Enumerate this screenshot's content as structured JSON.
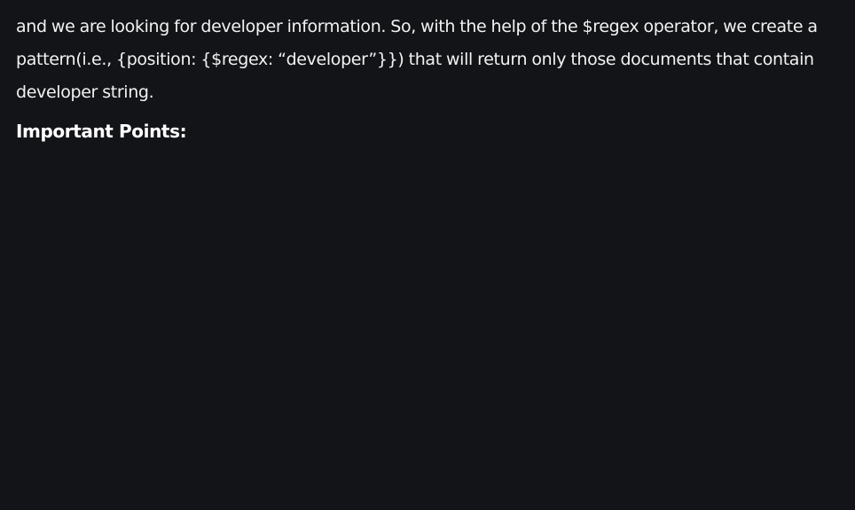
{
  "article": {
    "paragraph": "and we are looking for developer information. So, with the help of the $regex operator, we create a pattern(i.e., {position: {$regex: “developer”}}) that will return only those documents that contain developer string.",
    "heading": "Important Points:"
  }
}
